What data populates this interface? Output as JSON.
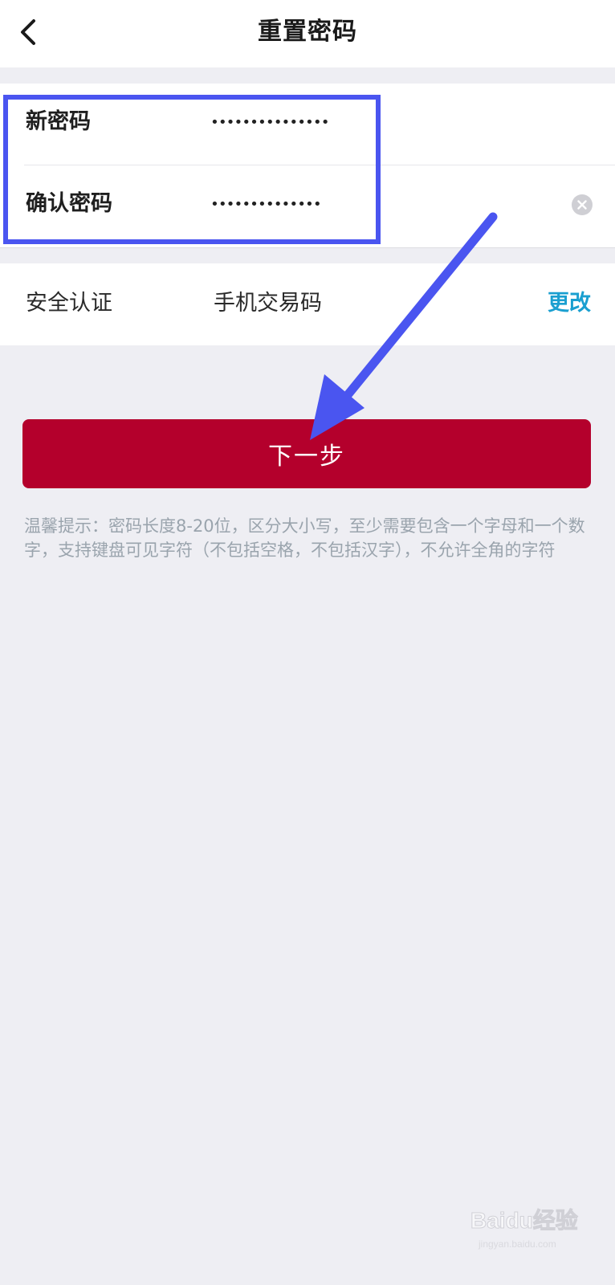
{
  "header": {
    "title": "重置密码",
    "back_icon": "chevron-left-icon"
  },
  "password_form": {
    "new_password": {
      "label": "新密码",
      "value": "•••••••••••••••"
    },
    "confirm_password": {
      "label": "确认密码",
      "value": "••••••••••••••",
      "clear_icon": "clear-circle-icon"
    }
  },
  "auth": {
    "label": "安全认证",
    "value": "手机交易码",
    "change_label": "更改"
  },
  "next_button": {
    "label": "下一步"
  },
  "tip": "温馨提示：密码长度8-20位，区分大小写，至少需要包含一个字母和一个数字，支持键盘可见字符（不包括空格，不包括汉字），不允许全角的字符",
  "watermark": {
    "brand": "Baidu经验",
    "url": "jingyan.baidu.com"
  },
  "colors": {
    "page_background": "#eeeef3",
    "primary_button": "#b4002c",
    "link": "#1a9fd0",
    "highlight": "#4a55f0",
    "tip_text": "#9aa4ad"
  }
}
